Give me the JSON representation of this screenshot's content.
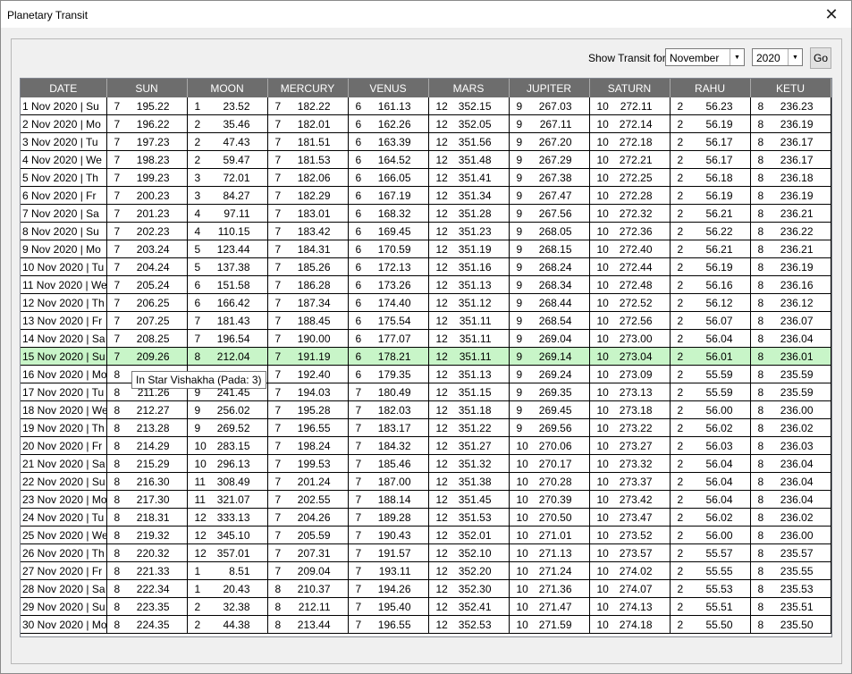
{
  "window": {
    "title": "Planetary Transit",
    "close_glyph": "✕"
  },
  "toolbar": {
    "show_label": "Show Transit for:",
    "month": "November",
    "year": "2020",
    "go_label": "Go"
  },
  "tooltip": "In Star Vishakha (Pada: 3)",
  "table": {
    "headers": [
      "DATE",
      "SUN",
      "MOON",
      "MERCURY",
      "VENUS",
      "MARS",
      "JUPITER",
      "SATURN",
      "RAHU",
      "KETU"
    ],
    "highlight_row": 14,
    "rows": [
      [
        "1 Nov 2020 | Su",
        "7",
        "195.22",
        "1",
        "23.52",
        "7",
        "182.22",
        "6",
        "161.13",
        "12",
        "352.15",
        "9",
        "267.03",
        "10",
        "272.11",
        "2",
        "56.23",
        "8",
        "236.23"
      ],
      [
        "2 Nov 2020 | Mo",
        "7",
        "196.22",
        "2",
        "35.46",
        "7",
        "182.01",
        "6",
        "162.26",
        "12",
        "352.05",
        "9",
        "267.11",
        "10",
        "272.14",
        "2",
        "56.19",
        "8",
        "236.19"
      ],
      [
        "3 Nov 2020 | Tu",
        "7",
        "197.23",
        "2",
        "47.43",
        "7",
        "181.51",
        "6",
        "163.39",
        "12",
        "351.56",
        "9",
        "267.20",
        "10",
        "272.18",
        "2",
        "56.17",
        "8",
        "236.17"
      ],
      [
        "4 Nov 2020 | We",
        "7",
        "198.23",
        "2",
        "59.47",
        "7",
        "181.53",
        "6",
        "164.52",
        "12",
        "351.48",
        "9",
        "267.29",
        "10",
        "272.21",
        "2",
        "56.17",
        "8",
        "236.17"
      ],
      [
        "5 Nov 2020 | Th",
        "7",
        "199.23",
        "3",
        "72.01",
        "7",
        "182.06",
        "6",
        "166.05",
        "12",
        "351.41",
        "9",
        "267.38",
        "10",
        "272.25",
        "2",
        "56.18",
        "8",
        "236.18"
      ],
      [
        "6 Nov 2020 | Fr",
        "7",
        "200.23",
        "3",
        "84.27",
        "7",
        "182.29",
        "6",
        "167.19",
        "12",
        "351.34",
        "9",
        "267.47",
        "10",
        "272.28",
        "2",
        "56.19",
        "8",
        "236.19"
      ],
      [
        "7 Nov 2020 | Sa",
        "7",
        "201.23",
        "4",
        "97.11",
        "7",
        "183.01",
        "6",
        "168.32",
        "12",
        "351.28",
        "9",
        "267.56",
        "10",
        "272.32",
        "2",
        "56.21",
        "8",
        "236.21"
      ],
      [
        "8 Nov 2020 | Su",
        "7",
        "202.23",
        "4",
        "110.15",
        "7",
        "183.42",
        "6",
        "169.45",
        "12",
        "351.23",
        "9",
        "268.05",
        "10",
        "272.36",
        "2",
        "56.22",
        "8",
        "236.22"
      ],
      [
        "9 Nov 2020 | Mo",
        "7",
        "203.24",
        "5",
        "123.44",
        "7",
        "184.31",
        "6",
        "170.59",
        "12",
        "351.19",
        "9",
        "268.15",
        "10",
        "272.40",
        "2",
        "56.21",
        "8",
        "236.21"
      ],
      [
        "10 Nov 2020 | Tu",
        "7",
        "204.24",
        "5",
        "137.38",
        "7",
        "185.26",
        "6",
        "172.13",
        "12",
        "351.16",
        "9",
        "268.24",
        "10",
        "272.44",
        "2",
        "56.19",
        "8",
        "236.19"
      ],
      [
        "11 Nov 2020 | We",
        "7",
        "205.24",
        "6",
        "151.58",
        "7",
        "186.28",
        "6",
        "173.26",
        "12",
        "351.13",
        "9",
        "268.34",
        "10",
        "272.48",
        "2",
        "56.16",
        "8",
        "236.16"
      ],
      [
        "12 Nov 2020 | Th",
        "7",
        "206.25",
        "6",
        "166.42",
        "7",
        "187.34",
        "6",
        "174.40",
        "12",
        "351.12",
        "9",
        "268.44",
        "10",
        "272.52",
        "2",
        "56.12",
        "8",
        "236.12"
      ],
      [
        "13 Nov 2020 | Fr",
        "7",
        "207.25",
        "7",
        "181.43",
        "7",
        "188.45",
        "6",
        "175.54",
        "12",
        "351.11",
        "9",
        "268.54",
        "10",
        "272.56",
        "2",
        "56.07",
        "8",
        "236.07"
      ],
      [
        "14 Nov 2020 | Sa",
        "7",
        "208.25",
        "7",
        "196.54",
        "7",
        "190.00",
        "6",
        "177.07",
        "12",
        "351.11",
        "9",
        "269.04",
        "10",
        "273.00",
        "2",
        "56.04",
        "8",
        "236.04"
      ],
      [
        "15 Nov 2020 | Su",
        "7",
        "209.26",
        "8",
        "212.04",
        "7",
        "191.19",
        "6",
        "178.21",
        "12",
        "351.11",
        "9",
        "269.14",
        "10",
        "273.04",
        "2",
        "56.01",
        "8",
        "236.01"
      ],
      [
        "16 Nov 2020 | Mo",
        "8",
        "",
        "",
        "",
        "7",
        "192.40",
        "6",
        "179.35",
        "12",
        "351.13",
        "9",
        "269.24",
        "10",
        "273.09",
        "2",
        "55.59",
        "8",
        "235.59"
      ],
      [
        "17 Nov 2020 | Tu",
        "8",
        "211.26",
        "9",
        "241.45",
        "7",
        "194.03",
        "7",
        "180.49",
        "12",
        "351.15",
        "9",
        "269.35",
        "10",
        "273.13",
        "2",
        "55.59",
        "8",
        "235.59"
      ],
      [
        "18 Nov 2020 | We",
        "8",
        "212.27",
        "9",
        "256.02",
        "7",
        "195.28",
        "7",
        "182.03",
        "12",
        "351.18",
        "9",
        "269.45",
        "10",
        "273.18",
        "2",
        "56.00",
        "8",
        "236.00"
      ],
      [
        "19 Nov 2020 | Th",
        "8",
        "213.28",
        "9",
        "269.52",
        "7",
        "196.55",
        "7",
        "183.17",
        "12",
        "351.22",
        "9",
        "269.56",
        "10",
        "273.22",
        "2",
        "56.02",
        "8",
        "236.02"
      ],
      [
        "20 Nov 2020 | Fr",
        "8",
        "214.29",
        "10",
        "283.15",
        "7",
        "198.24",
        "7",
        "184.32",
        "12",
        "351.27",
        "10",
        "270.06",
        "10",
        "273.27",
        "2",
        "56.03",
        "8",
        "236.03"
      ],
      [
        "21 Nov 2020 | Sa",
        "8",
        "215.29",
        "10",
        "296.13",
        "7",
        "199.53",
        "7",
        "185.46",
        "12",
        "351.32",
        "10",
        "270.17",
        "10",
        "273.32",
        "2",
        "56.04",
        "8",
        "236.04"
      ],
      [
        "22 Nov 2020 | Su",
        "8",
        "216.30",
        "11",
        "308.49",
        "7",
        "201.24",
        "7",
        "187.00",
        "12",
        "351.38",
        "10",
        "270.28",
        "10",
        "273.37",
        "2",
        "56.04",
        "8",
        "236.04"
      ],
      [
        "23 Nov 2020 | Mo",
        "8",
        "217.30",
        "11",
        "321.07",
        "7",
        "202.55",
        "7",
        "188.14",
        "12",
        "351.45",
        "10",
        "270.39",
        "10",
        "273.42",
        "2",
        "56.04",
        "8",
        "236.04"
      ],
      [
        "24 Nov 2020 | Tu",
        "8",
        "218.31",
        "12",
        "333.13",
        "7",
        "204.26",
        "7",
        "189.28",
        "12",
        "351.53",
        "10",
        "270.50",
        "10",
        "273.47",
        "2",
        "56.02",
        "8",
        "236.02"
      ],
      [
        "25 Nov 2020 | We",
        "8",
        "219.32",
        "12",
        "345.10",
        "7",
        "205.59",
        "7",
        "190.43",
        "12",
        "352.01",
        "10",
        "271.01",
        "10",
        "273.52",
        "2",
        "56.00",
        "8",
        "236.00"
      ],
      [
        "26 Nov 2020 | Th",
        "8",
        "220.32",
        "12",
        "357.01",
        "7",
        "207.31",
        "7",
        "191.57",
        "12",
        "352.10",
        "10",
        "271.13",
        "10",
        "273.57",
        "2",
        "55.57",
        "8",
        "235.57"
      ],
      [
        "27 Nov 2020 | Fr",
        "8",
        "221.33",
        "1",
        "8.51",
        "7",
        "209.04",
        "7",
        "193.11",
        "12",
        "352.20",
        "10",
        "271.24",
        "10",
        "274.02",
        "2",
        "55.55",
        "8",
        "235.55"
      ],
      [
        "28 Nov 2020 | Sa",
        "8",
        "222.34",
        "1",
        "20.43",
        "8",
        "210.37",
        "7",
        "194.26",
        "12",
        "352.30",
        "10",
        "271.36",
        "10",
        "274.07",
        "2",
        "55.53",
        "8",
        "235.53"
      ],
      [
        "29 Nov 2020 | Su",
        "8",
        "223.35",
        "2",
        "32.38",
        "8",
        "212.11",
        "7",
        "195.40",
        "12",
        "352.41",
        "10",
        "271.47",
        "10",
        "274.13",
        "2",
        "55.51",
        "8",
        "235.51"
      ],
      [
        "30 Nov 2020 | Mo",
        "8",
        "224.35",
        "2",
        "44.38",
        "8",
        "213.44",
        "7",
        "196.55",
        "12",
        "352.53",
        "10",
        "271.59",
        "10",
        "274.18",
        "2",
        "55.50",
        "8",
        "235.50"
      ]
    ]
  }
}
